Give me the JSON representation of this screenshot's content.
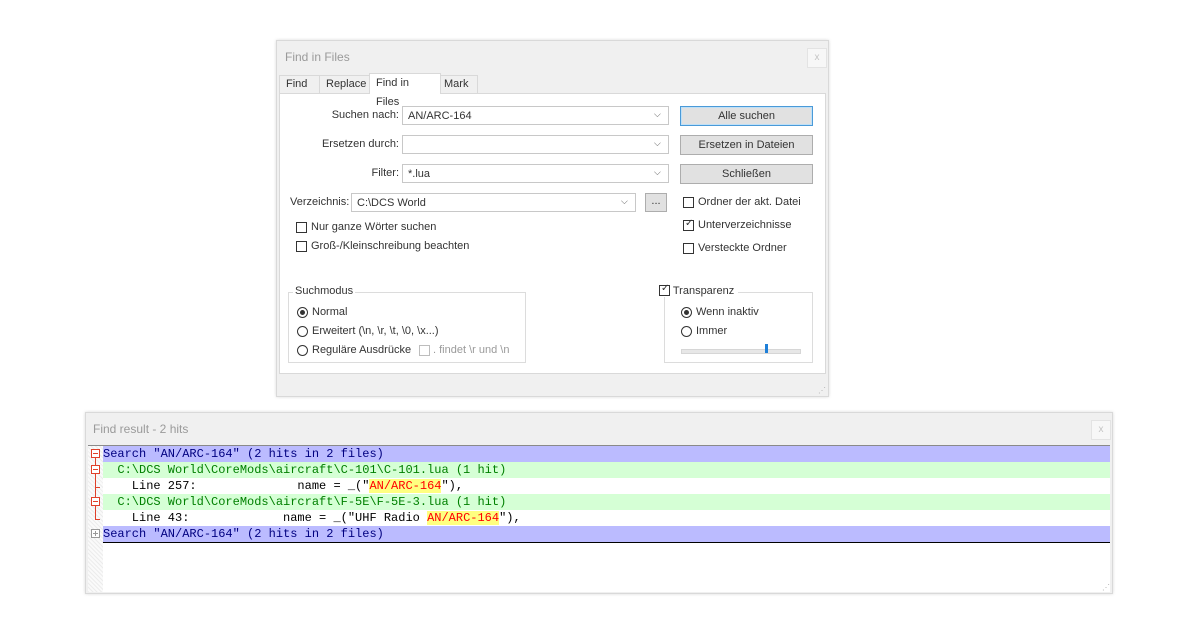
{
  "dialog": {
    "title": "Find in Files",
    "close": "x",
    "tabs": [
      "Find",
      "Replace",
      "Find in Files",
      "Mark"
    ],
    "find_label": "Suchen nach:",
    "find_value": "AN/ARC-164",
    "replace_label": "Ersetzen durch:",
    "replace_value": "",
    "filter_label": "Filter:",
    "filter_value": "*.lua",
    "dir_label": "Verzeichnis:",
    "dir_value": "C:\\DCS World",
    "browse": "...",
    "btn_find_all": "Alle suchen",
    "btn_replace_files": "Ersetzen in Dateien",
    "btn_close": "Schließen",
    "opt_current_dir": "Ordner der akt. Datei",
    "opt_subfolders": "Unterverzeichnisse",
    "opt_hidden": "Versteckte Ordner",
    "opt_whole_word": "Nur ganze Wörter suchen",
    "opt_match_case": "Groß-/Kleinschreibung beachten",
    "search_mode_title": "Suchmodus",
    "mode_normal": "Normal",
    "mode_extended": "Erweitert (\\n, \\r, \\t, \\0, \\x...)",
    "mode_regex": "Reguläre Ausdrücke",
    "dot_newline": ". findet \\r und \\n",
    "transparency_label": "Transparenz",
    "trans_inactive": "Wenn inaktiv",
    "trans_always": "Immer",
    "state": {
      "current_dir": false,
      "subfolders": true,
      "hidden": false,
      "whole_word": false,
      "match_case": false,
      "transparency": true,
      "mode": "Normal",
      "trans_mode": "Wenn inaktiv",
      "transparency_level": 0.72
    }
  },
  "results": {
    "title": "Find result - 2 hits",
    "close": "x",
    "lines": [
      {
        "kind": "hdr",
        "text": "Search \"AN/ARC-164\" (2 hits in 2 files)"
      },
      {
        "kind": "file",
        "text": "  C:\\DCS World\\CoreMods\\aircraft\\C-101\\C-101.lua (1 hit)"
      },
      {
        "kind": "hit",
        "pre": "    Line 257:              name = _(\"",
        "match": "AN/ARC-164",
        "post": "\"),"
      },
      {
        "kind": "file",
        "text": "  C:\\DCS World\\CoreMods\\aircraft\\F-5E\\F-5E-3.lua (1 hit)"
      },
      {
        "kind": "hit",
        "pre": "    Line 43:             name = _(\"UHF Radio ",
        "match": "AN/ARC-164",
        "post": "\"),"
      },
      {
        "kind": "hdr",
        "text": "Search \"AN/ARC-164\" (2 hits in 2 files)"
      }
    ]
  },
  "colors": {
    "header_bg": "#bbbbff",
    "file_bg": "#d5ffd5",
    "match_bg": "#ffff80",
    "match_fg": "#ff0000"
  }
}
